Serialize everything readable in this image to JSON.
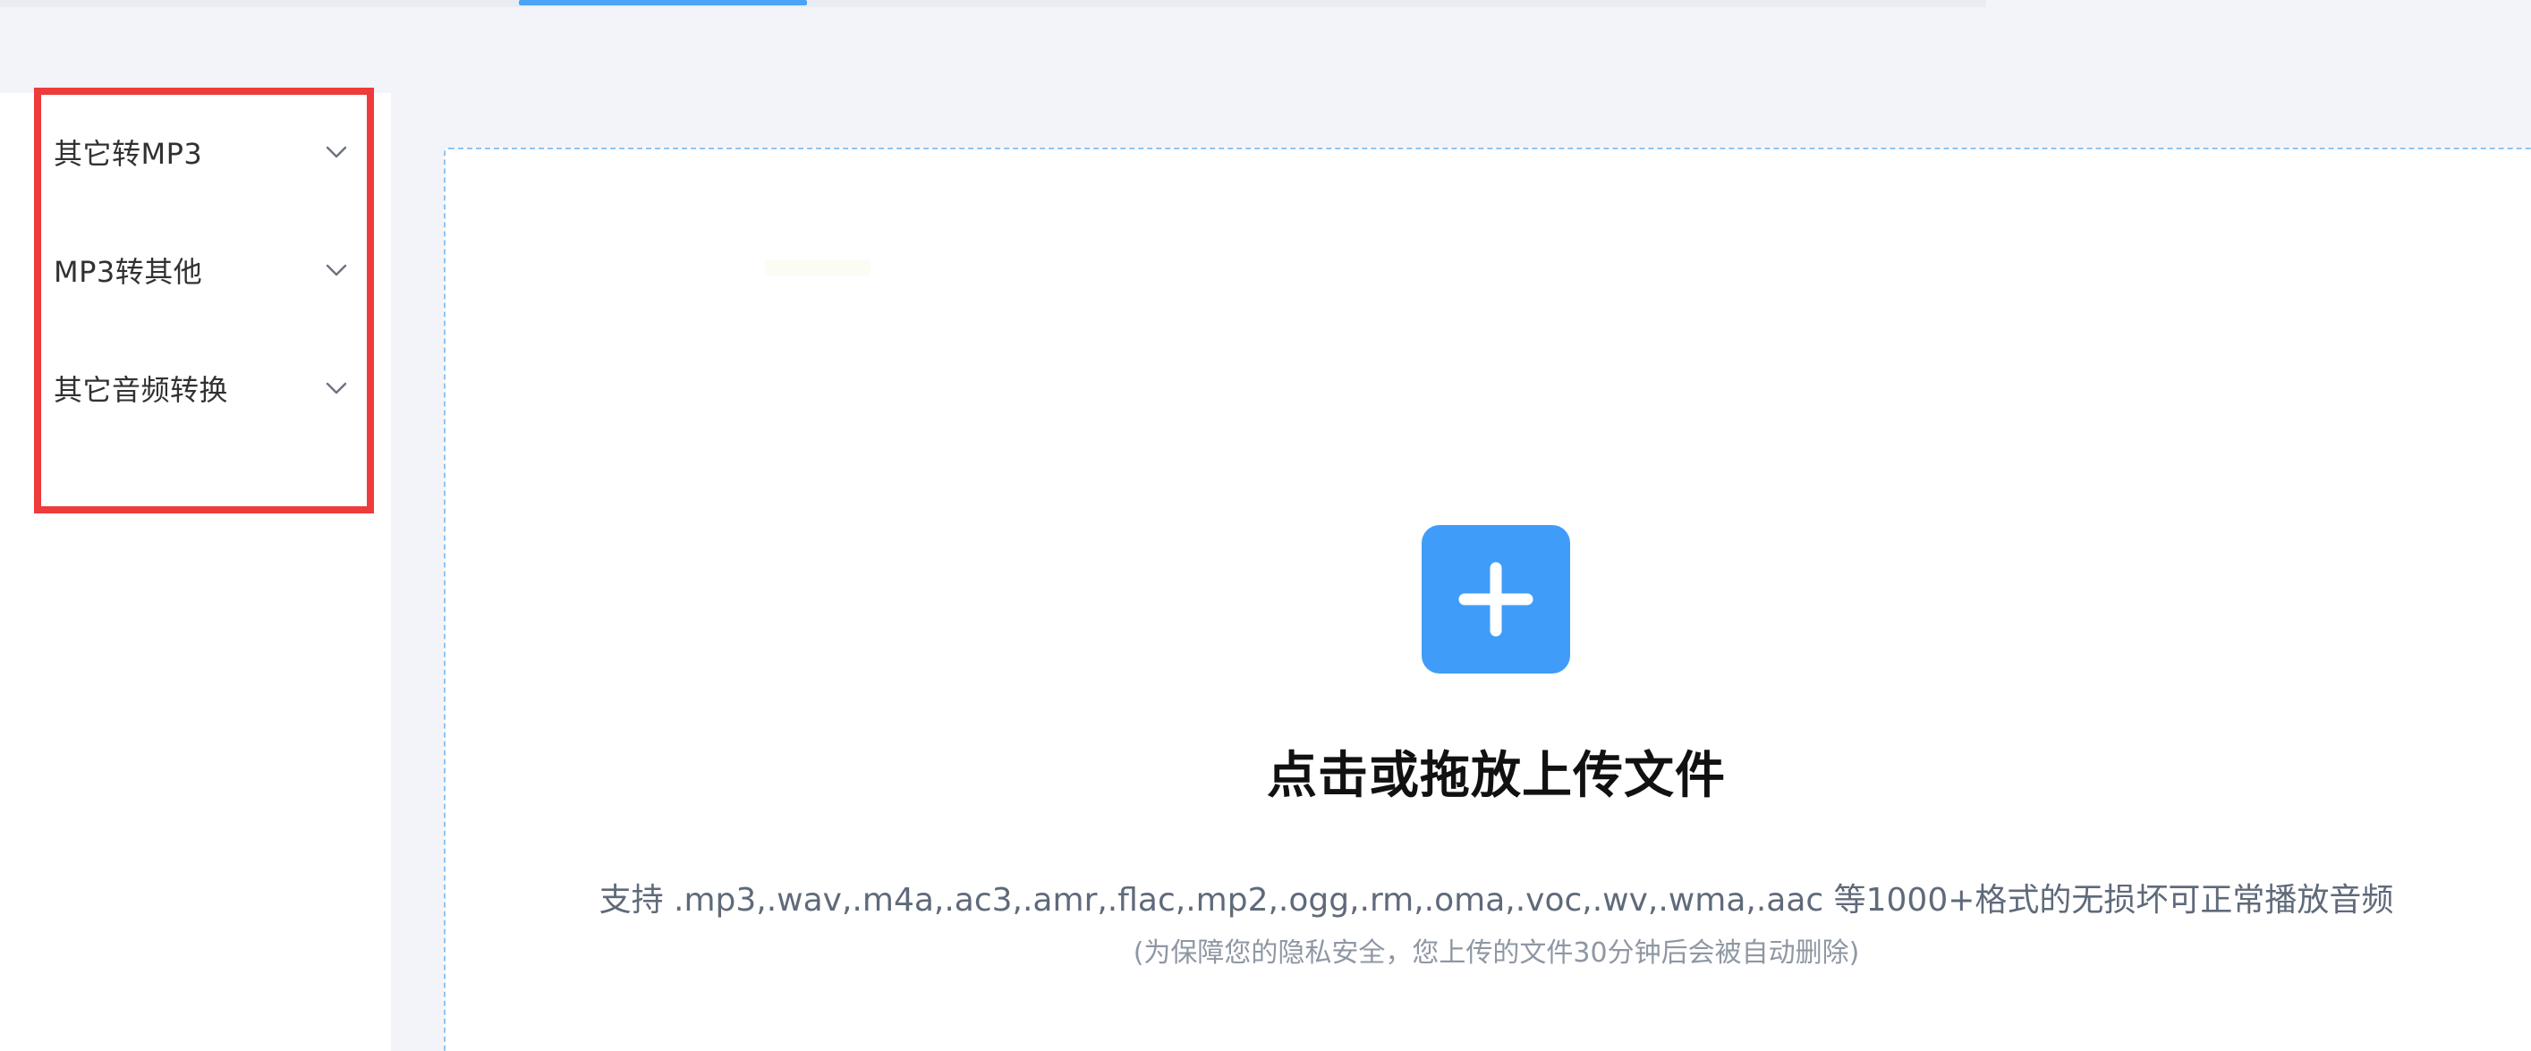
{
  "sidebar": {
    "items": [
      {
        "label": "其它转MP3",
        "icon": "chevron-down-icon"
      },
      {
        "label": "MP3转其他",
        "icon": "chevron-down-icon"
      },
      {
        "label": "其它音频转换",
        "icon": "chevron-down-icon"
      }
    ]
  },
  "upload": {
    "icon": "plus-icon",
    "title": "点击或拖放上传文件",
    "formats": "支持 .mp3,.wav,.m4a,.ac3,.amr,.flac,.mp2,.ogg,.rm,.oma,.voc,.wv,.wma,.aac 等1000+格式的无损坏可正常播放音频",
    "note": "(为保障您的隐私安全，您上传的文件30分钟后会被自动删除)"
  },
  "colors": {
    "accent": "#409cf9",
    "highlight": "#ee3b3b",
    "upload_border": "#8ec5f5",
    "background": "#f2f4f9"
  }
}
